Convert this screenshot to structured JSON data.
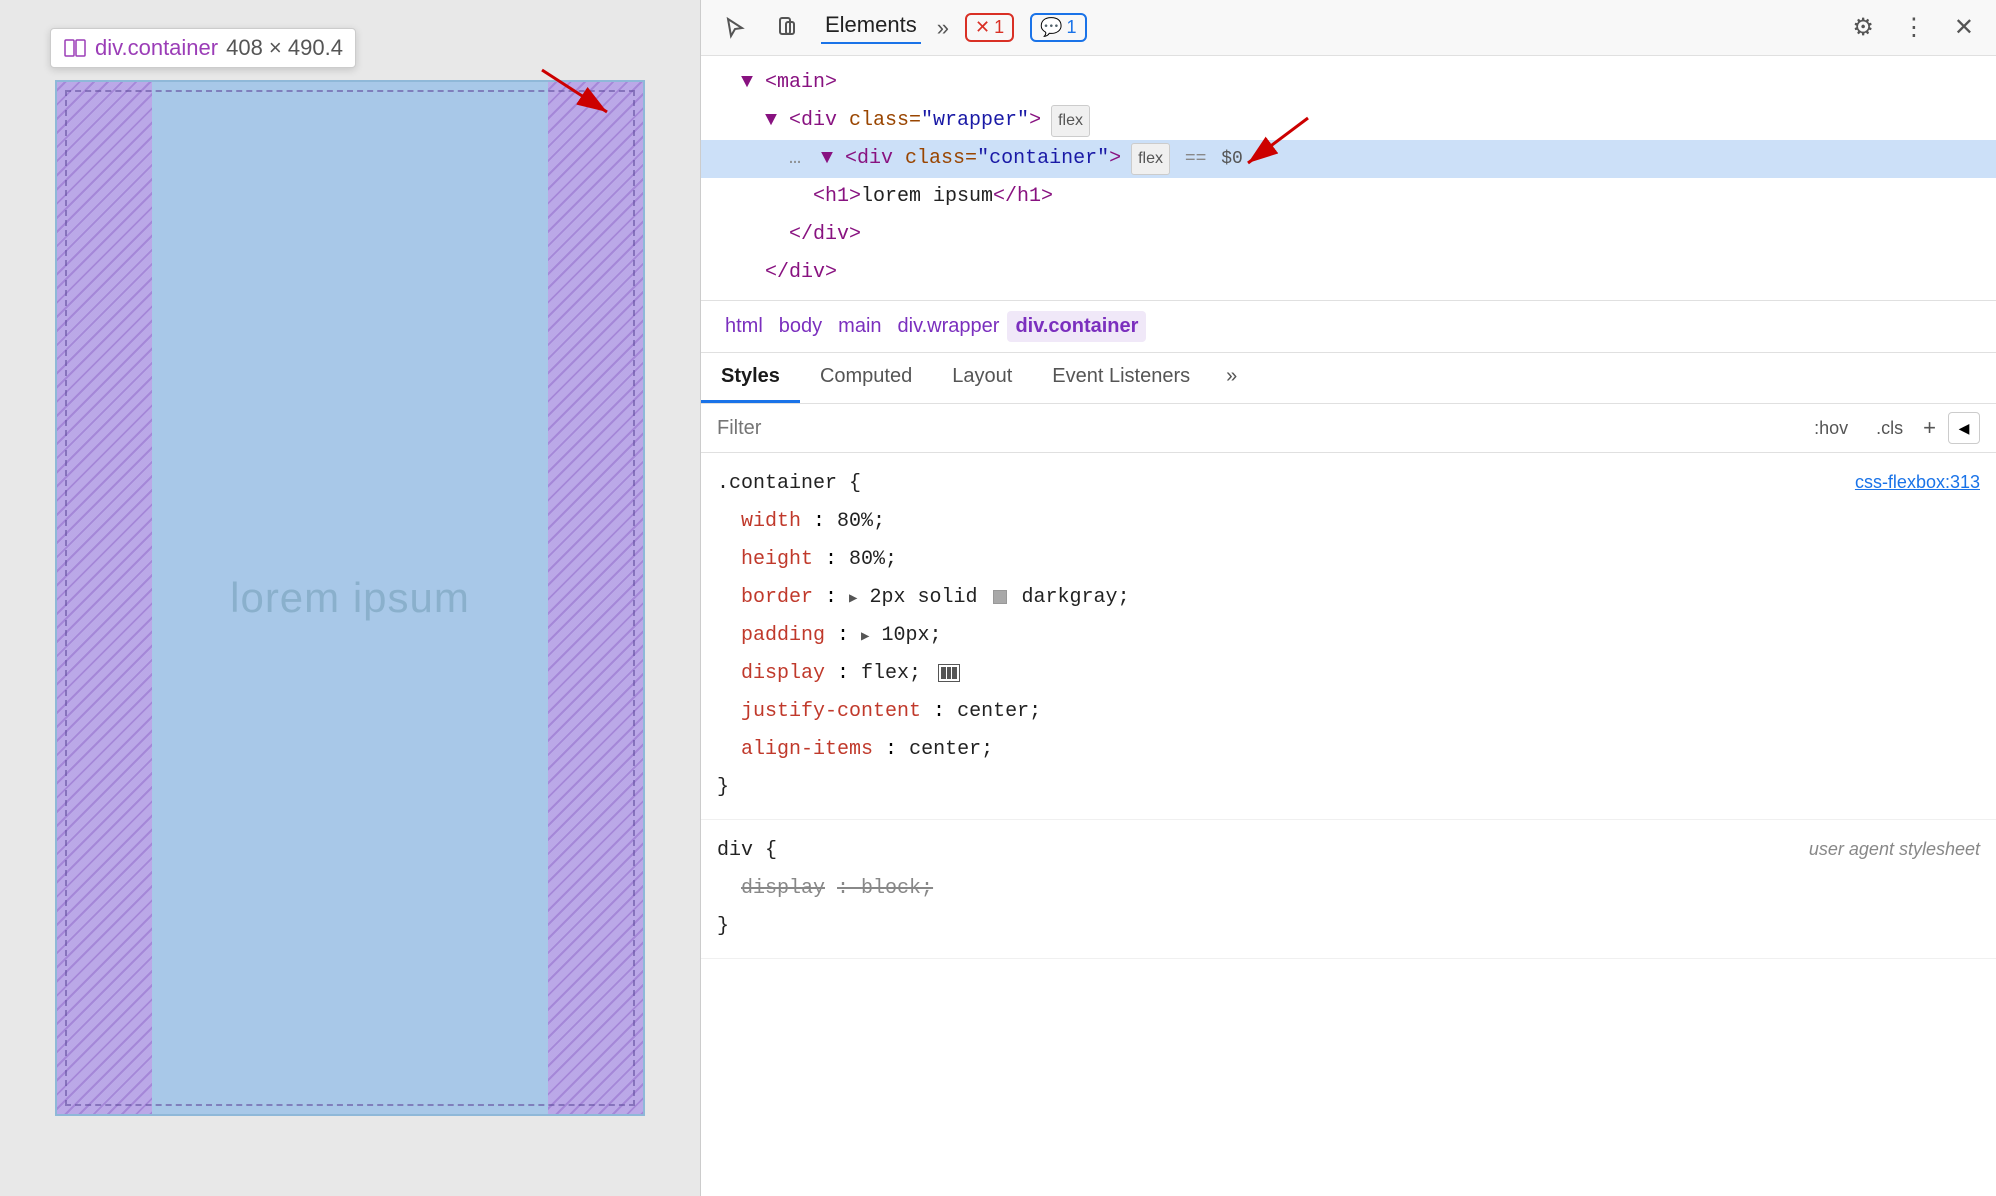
{
  "tooltip": {
    "icon": "⊞",
    "name": "div.container",
    "size": "408 × 490.4"
  },
  "lorem": "lorem ipsum",
  "devtools": {
    "toolbar": {
      "elements_tab": "Elements",
      "more_icon": "»",
      "error_count": "1",
      "message_count": "1",
      "gear_label": "⚙",
      "dots_label": "⋮",
      "close_label": "✕"
    },
    "dom": {
      "lines": [
        {
          "indent": 1,
          "content": "▼ <main>"
        },
        {
          "indent": 2,
          "content": "▼ <div class=\"wrapper\">",
          "badge": "flex"
        },
        {
          "indent": 3,
          "content": "▼ <div class=\"container\">",
          "badge": "flex",
          "selected": true,
          "eq": "==",
          "dollar": "$0"
        },
        {
          "indent": 4,
          "content": "<h1>lorem ipsum</h1>"
        },
        {
          "indent": 3,
          "content": "</div>"
        },
        {
          "indent": 2,
          "content": "</div>"
        }
      ]
    },
    "breadcrumb": [
      "html",
      "body",
      "main",
      "div.wrapper",
      "div.container"
    ],
    "tabs": [
      "Styles",
      "Computed",
      "Layout",
      "Event Listeners",
      "»"
    ],
    "filter": {
      "placeholder": "Filter",
      "hov": ":hov",
      "cls": ".cls",
      "plus": "+",
      "icon": "◀"
    },
    "rules": [
      {
        "selector": ".container {",
        "source": "css-flexbox:313",
        "closing": "}",
        "properties": [
          {
            "prop": "width",
            "value": "80%;"
          },
          {
            "prop": "height",
            "value": "80%;"
          },
          {
            "prop": "border",
            "value": "▶ 2px solid",
            "color_swatch": true,
            "value2": "darkgray;"
          },
          {
            "prop": "padding",
            "value": "▶ 10px;"
          },
          {
            "prop": "display",
            "value": "flex;",
            "flex_icon": true
          },
          {
            "prop": "justify-content",
            "value": "center;"
          },
          {
            "prop": "align-items",
            "value": "center;"
          }
        ]
      },
      {
        "selector": "div {",
        "source": "user agent stylesheet",
        "source_italic": true,
        "closing": "}",
        "properties": [
          {
            "prop": "display",
            "value": "block;",
            "strikethrough": true
          }
        ]
      }
    ]
  }
}
